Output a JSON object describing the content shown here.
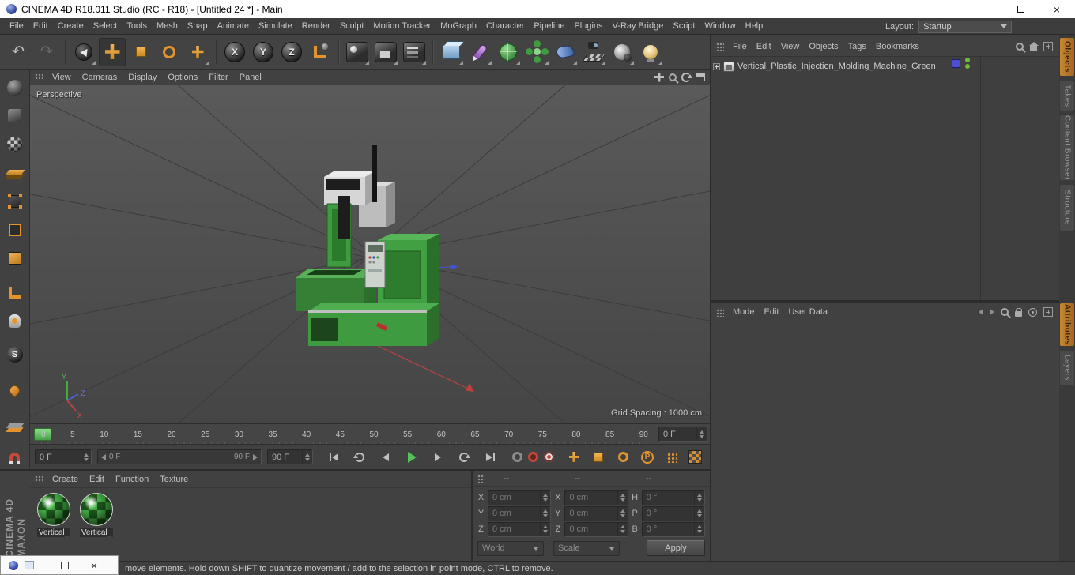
{
  "titlebar": {
    "title": "CINEMA 4D R18.011 Studio (RC - R18) - [Untitled 24 *] - Main"
  },
  "menubar": {
    "items": [
      "File",
      "Edit",
      "Create",
      "Select",
      "Tools",
      "Mesh",
      "Snap",
      "Animate",
      "Simulate",
      "Render",
      "Sculpt",
      "Motion Tracker",
      "MoGraph",
      "Character",
      "Pipeline",
      "Plugins",
      "V-Ray Bridge",
      "Script",
      "Window",
      "Help"
    ],
    "layout_label": "Layout:",
    "layout_value": "Startup"
  },
  "toolbar": {
    "axis_x": "X",
    "axis_y": "Y",
    "axis_z": "Z"
  },
  "left_palette": {
    "solo_letter": "S"
  },
  "viewport": {
    "menu": [
      "View",
      "Cameras",
      "Display",
      "Options",
      "Filter",
      "Panel"
    ],
    "camera_label": "Perspective",
    "grid_spacing_label": "Grid Spacing : 1000 cm",
    "axis_x": "X",
    "axis_y": "Y",
    "axis_z": "Z"
  },
  "object_manager": {
    "menu": [
      "File",
      "Edit",
      "View",
      "Objects",
      "Tags",
      "Bookmarks"
    ],
    "object_name": "Vertical_Plastic_Injection_Molding_Machine_Green"
  },
  "attribute_manager": {
    "menu": [
      "Mode",
      "Edit",
      "User Data"
    ]
  },
  "side_tabs": {
    "top": [
      "Objects",
      "Takes",
      "Content Browser",
      "Structure"
    ],
    "bottom": [
      "Attributes",
      "Layers"
    ]
  },
  "timeline": {
    "ticks": [
      "0",
      "5",
      "10",
      "15",
      "20",
      "25",
      "30",
      "35",
      "40",
      "45",
      "50",
      "55",
      "60",
      "65",
      "70",
      "75",
      "80",
      "85",
      "90"
    ],
    "frame_field": "0 F",
    "start_field": "0 F",
    "range_start": "0 F",
    "range_end": "90 F",
    "end_field": "90 F",
    "param_letter": "P"
  },
  "materials": {
    "menu": [
      "Create",
      "Edit",
      "Function",
      "Texture"
    ],
    "items": [
      {
        "label": "Vertical_"
      },
      {
        "label": "Vertical_"
      }
    ]
  },
  "coordinates": {
    "headers": [
      "--",
      "--",
      "--"
    ],
    "rows": [
      {
        "l1": "X",
        "v1": "0 cm",
        "l2": "X",
        "v2": "0 cm",
        "l3": "H",
        "v3": "0 °"
      },
      {
        "l1": "Y",
        "v1": "0 cm",
        "l2": "Y",
        "v2": "0 cm",
        "l3": "P",
        "v3": "0 °"
      },
      {
        "l1": "Z",
        "v1": "0 cm",
        "l2": "Z",
        "v2": "0 cm",
        "l3": "B",
        "v3": "0 °"
      }
    ],
    "space_dropdown": "World",
    "scale_dropdown": "Scale",
    "apply_label": "Apply"
  },
  "statusbar": {
    "text": "move elements. Hold down SHIFT to quantize movement / add to the selection in point mode, CTRL to remove."
  },
  "branding": {
    "line1": "MAXON",
    "line2": "CINEMA 4D"
  },
  "colors": {
    "accent_orange": "#e2952f",
    "model_green": "#3f9b3f",
    "axis_red": "#c04040",
    "axis_blue": "#4053c8",
    "play_green": "#54b854"
  }
}
